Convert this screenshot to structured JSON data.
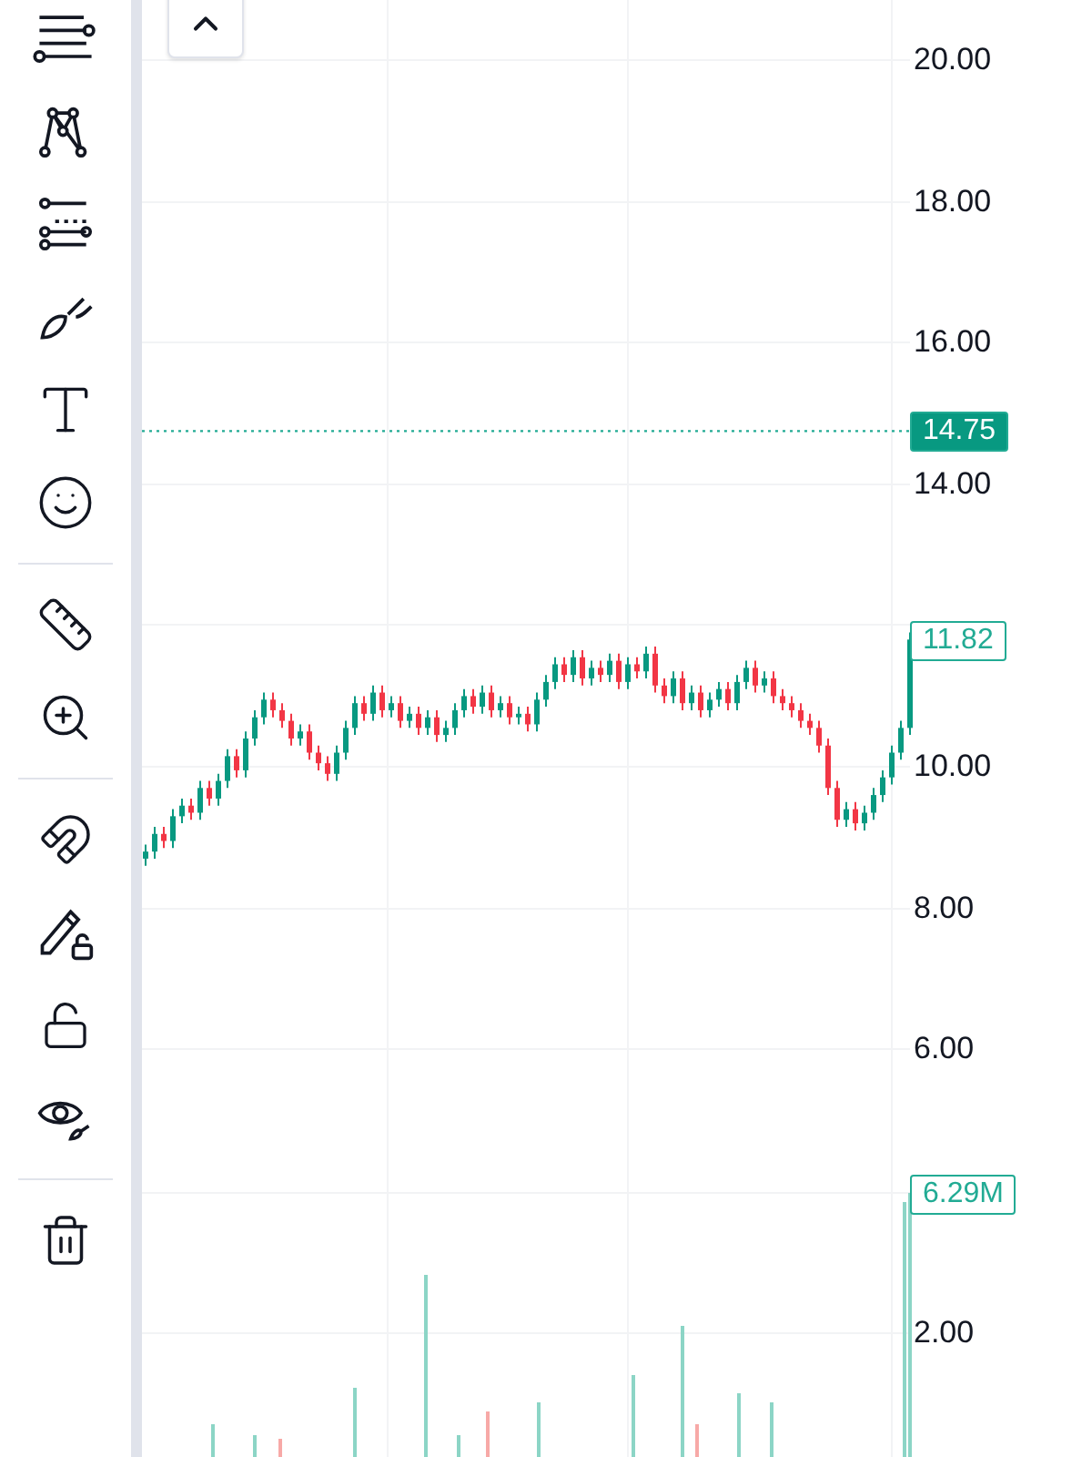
{
  "price_chart": {
    "chart_data": {
      "type": "candlestick",
      "ylim": [
        3.97,
        20.85
      ],
      "grid": true,
      "ref_lines": [
        {
          "axis": "y",
          "value": 14.75,
          "label": "14.75"
        }
      ],
      "yticks": [
        {
          "value": 20,
          "label": "20.00"
        },
        {
          "value": 18,
          "label": "18.00"
        },
        {
          "value": 16,
          "label": "16.00"
        },
        {
          "value": 14,
          "label": "14.00"
        },
        {
          "value": 10,
          "label": "10.00"
        },
        {
          "value": 8,
          "label": "8.00"
        },
        {
          "value": 6,
          "label": "6.00"
        }
      ],
      "ohlc": [
        [
          8.7,
          8.9,
          8.6,
          8.8
        ],
        [
          8.8,
          9.15,
          8.7,
          9.05
        ],
        [
          9.05,
          9.15,
          8.85,
          8.95
        ],
        [
          8.95,
          9.4,
          8.85,
          9.3
        ],
        [
          9.3,
          9.55,
          9.2,
          9.45
        ],
        [
          9.45,
          9.55,
          9.25,
          9.35
        ],
        [
          9.35,
          9.8,
          9.25,
          9.7
        ],
        [
          9.7,
          9.8,
          9.45,
          9.55
        ],
        [
          9.55,
          9.9,
          9.45,
          9.8
        ],
        [
          9.8,
          10.25,
          9.7,
          10.15
        ],
        [
          10.15,
          10.25,
          9.85,
          9.95
        ],
        [
          9.95,
          10.5,
          9.85,
          10.4
        ],
        [
          10.4,
          10.8,
          10.3,
          10.7
        ],
        [
          10.7,
          11.05,
          10.6,
          10.95
        ],
        [
          10.95,
          11.05,
          10.7,
          10.8
        ],
        [
          10.8,
          10.9,
          10.55,
          10.65
        ],
        [
          10.65,
          10.75,
          10.3,
          10.4
        ],
        [
          10.4,
          10.6,
          10.3,
          10.5
        ],
        [
          10.5,
          10.6,
          10.1,
          10.2
        ],
        [
          10.2,
          10.3,
          9.95,
          10.05
        ],
        [
          10.05,
          10.15,
          9.8,
          9.9
        ],
        [
          9.9,
          10.3,
          9.8,
          10.2
        ],
        [
          10.2,
          10.65,
          10.1,
          10.55
        ],
        [
          10.55,
          11.0,
          10.45,
          10.9
        ],
        [
          10.9,
          11.0,
          10.65,
          10.75
        ],
        [
          10.75,
          11.15,
          10.65,
          11.05
        ],
        [
          11.05,
          11.15,
          10.7,
          10.8
        ],
        [
          10.8,
          11.0,
          10.7,
          10.9
        ],
        [
          10.9,
          11.0,
          10.55,
          10.65
        ],
        [
          10.65,
          10.85,
          10.55,
          10.75
        ],
        [
          10.75,
          10.85,
          10.45,
          10.55
        ],
        [
          10.55,
          10.8,
          10.45,
          10.7
        ],
        [
          10.7,
          10.8,
          10.35,
          10.45
        ],
        [
          10.45,
          10.65,
          10.35,
          10.55
        ],
        [
          10.55,
          10.9,
          10.45,
          10.8
        ],
        [
          10.8,
          11.1,
          10.7,
          11.0
        ],
        [
          11.0,
          11.1,
          10.75,
          10.85
        ],
        [
          10.85,
          11.15,
          10.75,
          11.05
        ],
        [
          11.05,
          11.15,
          10.7,
          10.8
        ],
        [
          10.8,
          11.0,
          10.7,
          10.9
        ],
        [
          10.9,
          11.0,
          10.6,
          10.7
        ],
        [
          10.7,
          10.85,
          10.6,
          10.75
        ],
        [
          10.75,
          10.85,
          10.5,
          10.6
        ],
        [
          10.6,
          11.05,
          10.5,
          10.95
        ],
        [
          10.95,
          11.3,
          10.85,
          11.2
        ],
        [
          11.2,
          11.55,
          11.1,
          11.45
        ],
        [
          11.45,
          11.55,
          11.2,
          11.3
        ],
        [
          11.3,
          11.65,
          11.2,
          11.55
        ],
        [
          11.55,
          11.65,
          11.15,
          11.25
        ],
        [
          11.25,
          11.5,
          11.15,
          11.4
        ],
        [
          11.4,
          11.5,
          11.2,
          11.3
        ],
        [
          11.3,
          11.6,
          11.2,
          11.5
        ],
        [
          11.5,
          11.6,
          11.1,
          11.2
        ],
        [
          11.2,
          11.55,
          11.1,
          11.45
        ],
        [
          11.45,
          11.55,
          11.25,
          11.35
        ],
        [
          11.35,
          11.7,
          11.25,
          11.6
        ],
        [
          11.6,
          11.7,
          11.05,
          11.15
        ],
        [
          11.15,
          11.25,
          10.9,
          11.0
        ],
        [
          11.0,
          11.35,
          10.9,
          11.25
        ],
        [
          11.25,
          11.35,
          10.8,
          10.9
        ],
        [
          10.9,
          11.15,
          10.8,
          11.05
        ],
        [
          11.05,
          11.15,
          10.7,
          10.8
        ],
        [
          10.8,
          11.05,
          10.7,
          10.95
        ],
        [
          10.95,
          11.2,
          10.85,
          11.1
        ],
        [
          11.1,
          11.2,
          10.8,
          10.9
        ],
        [
          10.9,
          11.3,
          10.8,
          11.2
        ],
        [
          11.2,
          11.5,
          11.1,
          11.4
        ],
        [
          11.4,
          11.5,
          11.05,
          11.15
        ],
        [
          11.15,
          11.35,
          11.05,
          11.25
        ],
        [
          11.25,
          11.35,
          10.9,
          11.0
        ],
        [
          11.0,
          11.1,
          10.8,
          10.9
        ],
        [
          10.9,
          11.0,
          10.7,
          10.8
        ],
        [
          10.8,
          10.9,
          10.55,
          10.65
        ],
        [
          10.65,
          10.75,
          10.45,
          10.55
        ],
        [
          10.55,
          10.65,
          10.2,
          10.3
        ],
        [
          10.3,
          10.4,
          9.6,
          9.7
        ],
        [
          9.7,
          9.8,
          9.15,
          9.25
        ],
        [
          9.25,
          9.5,
          9.15,
          9.4
        ],
        [
          9.4,
          9.5,
          9.1,
          9.2
        ],
        [
          9.2,
          9.45,
          9.1,
          9.35
        ],
        [
          9.35,
          9.7,
          9.25,
          9.6
        ],
        [
          9.6,
          9.95,
          9.5,
          9.85
        ],
        [
          9.85,
          10.3,
          9.75,
          10.2
        ],
        [
          10.2,
          10.65,
          10.1,
          10.55
        ],
        [
          10.55,
          11.9,
          10.45,
          11.8
        ]
      ]
    }
  },
  "current_price": {
    "label": "11.82"
  },
  "volume": {
    "label": "6.29M",
    "ticks": [
      "2.00"
    ]
  }
}
